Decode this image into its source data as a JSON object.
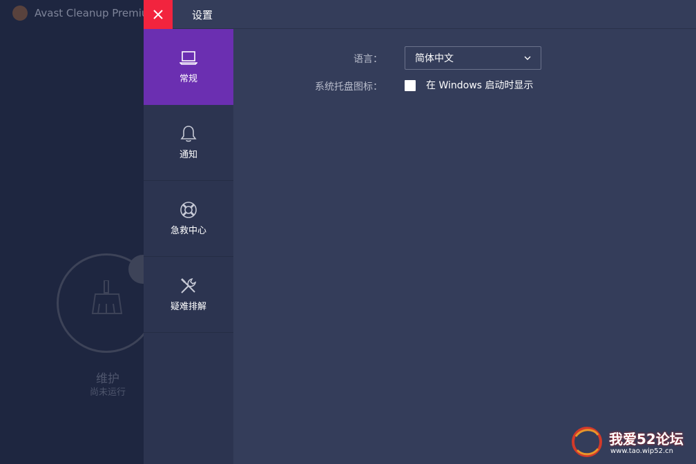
{
  "background_app": {
    "title": "Avast Cleanup Premium",
    "card_title": "维护",
    "card_subtitle": "尚未运行"
  },
  "header": {
    "title": "设置",
    "close_icon": "close-icon"
  },
  "sidebar": {
    "items": [
      {
        "label": "常规",
        "icon": "laptop-icon",
        "active": true
      },
      {
        "label": "通知",
        "icon": "bell-icon",
        "active": false
      },
      {
        "label": "急救中心",
        "icon": "lifebuoy-icon",
        "active": false
      },
      {
        "label": "疑难排解",
        "icon": "tools-icon",
        "active": false
      }
    ]
  },
  "settings": {
    "language_label": "语言：",
    "language_value": "简体中文",
    "tray_label": "系统托盘图标：",
    "tray_checkbox_text": "在 Windows 启动时显示",
    "tray_checked": false
  },
  "watermark": {
    "text": "我爱52论坛",
    "url": "www.tao.wip52.cn"
  },
  "colors": {
    "panel_bg": "#343d5a",
    "sidebar_bg": "#2c3450",
    "active_item": "#6b2fb1",
    "close_button": "#f2243e"
  }
}
